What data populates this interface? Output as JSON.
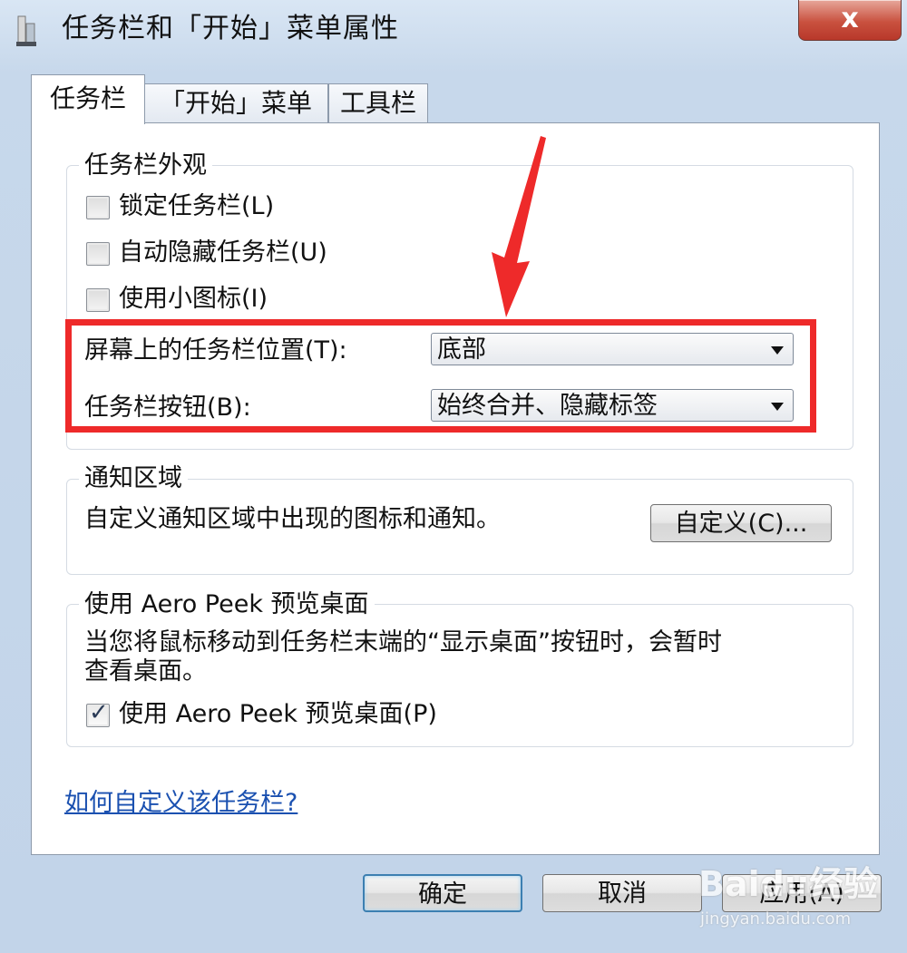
{
  "window": {
    "title": "任务栏和「开始」菜单属性",
    "close_glyph": "x"
  },
  "tabs": [
    {
      "label": "任务栏",
      "active": true
    },
    {
      "label": "「开始」菜单",
      "active": false
    },
    {
      "label": "工具栏",
      "active": false
    }
  ],
  "taskbar_appearance": {
    "title": "任务栏外观",
    "lock_taskbar": {
      "label": "锁定任务栏(L)",
      "checked": false
    },
    "auto_hide": {
      "label": "自动隐藏任务栏(U)",
      "checked": false
    },
    "small_icons": {
      "label": "使用小图标(I)",
      "checked": false
    },
    "position_label": "屏幕上的任务栏位置(T):",
    "position_value": "底部",
    "buttons_label": "任务栏按钮(B):",
    "buttons_value": "始终合并、隐藏标签"
  },
  "notification_area": {
    "title": "通知区域",
    "description": "自定义通知区域中出现的图标和通知。",
    "customize_button": "自定义(C)..."
  },
  "aero_peek": {
    "title": "使用 Aero Peek 预览桌面",
    "description_line1": "当您将鼠标移动到任务栏末端的“显示桌面”按钮时，会暂时",
    "description_line2": "查看桌面。",
    "checkbox": {
      "label": "使用 Aero Peek 预览桌面(P)",
      "checked": true
    }
  },
  "help_link": "如何自定义该任务栏?",
  "buttons": {
    "ok": "确定",
    "cancel": "取消",
    "apply": "应用(A)"
  },
  "watermark": {
    "logo": "Baidu经验",
    "url": "jingyan.baidu.com"
  },
  "colors": {
    "highlight": "#ee2a2a",
    "link": "#1a50b0"
  }
}
